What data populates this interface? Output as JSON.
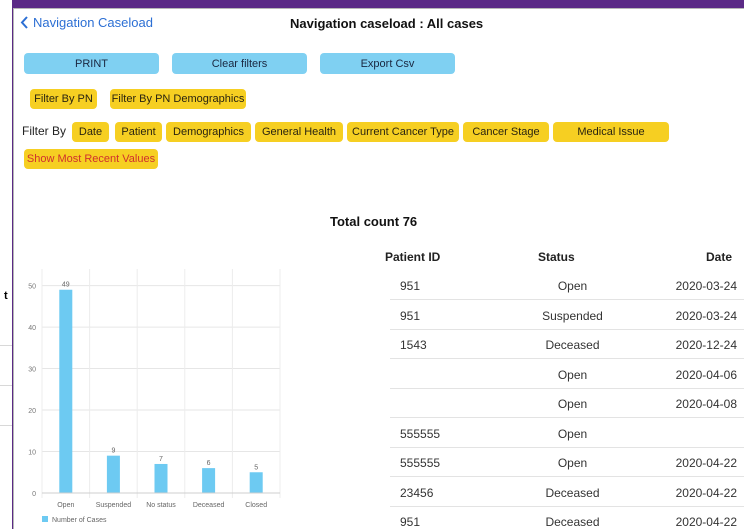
{
  "side": {
    "fragment": "t"
  },
  "header": {
    "back_label": "Navigation Caseload",
    "title": "Navigation caseload : All cases"
  },
  "actions": {
    "print": "PRINT",
    "clear": "Clear filters",
    "export": "Export Csv"
  },
  "pn_filters": [
    "Filter By PN",
    "Filter By PN Demographics"
  ],
  "filter_by_label": "Filter By",
  "filters": [
    "Date",
    "Patient",
    "Demographics",
    "General Health",
    "Current Cancer Type",
    "Cancer Stage",
    "Medical Issue"
  ],
  "recent_toggle": "Show Most Recent Values",
  "colors": {
    "accent_blue": "#7fd0f2",
    "chip_yellow": "#f6cf22",
    "bar": "#6dcaf2",
    "link": "#2c6fd4",
    "frame": "#5b2a86"
  },
  "total_count_label": "Total count 76",
  "chart_data": {
    "type": "bar",
    "categories": [
      "Open",
      "Suspended",
      "No status",
      "Deceased",
      "Closed"
    ],
    "series": [
      {
        "name": "Number of Cases",
        "values": [
          49,
          9,
          7,
          6,
          5
        ]
      }
    ],
    "yticks": [
      0,
      10,
      20,
      30,
      40,
      50
    ],
    "ylim": [
      0,
      54
    ],
    "grid": true,
    "legend": "bottom-left"
  },
  "table": {
    "headers": [
      "Patient ID",
      "Status",
      "Date"
    ],
    "rows": [
      [
        "951",
        "Open",
        "2020-03-24"
      ],
      [
        "951",
        "Suspended",
        "2020-03-24"
      ],
      [
        "1543",
        "Deceased",
        "2020-12-24"
      ],
      [
        "",
        "Open",
        "2020-04-06"
      ],
      [
        "",
        "Open",
        "2020-04-08"
      ],
      [
        "555555",
        "Open",
        ""
      ],
      [
        "555555",
        "Open",
        "2020-04-22"
      ],
      [
        "23456",
        "Deceased",
        "2020-04-22"
      ],
      [
        "951",
        "Deceased",
        "2020-04-22"
      ]
    ]
  }
}
